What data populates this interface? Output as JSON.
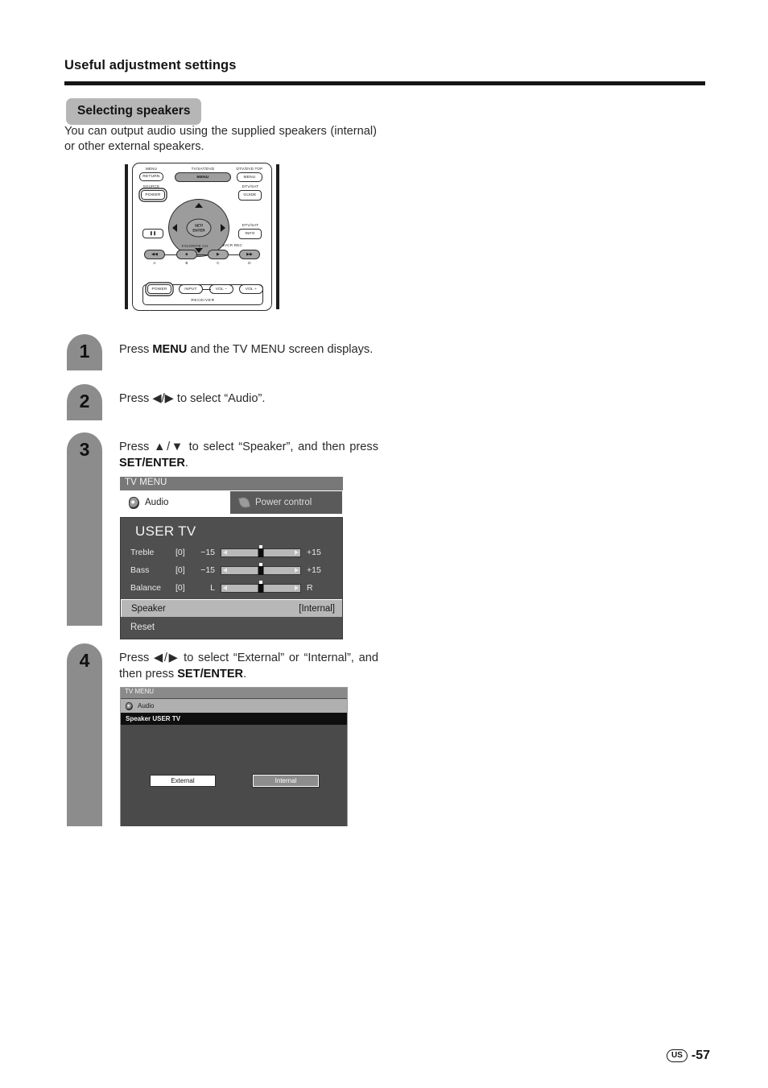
{
  "header": {
    "title": "Useful adjustment settings",
    "section_chip": "Selecting speakers",
    "intro": "You can output audio using the supplied speakers (internal) or other external speakers."
  },
  "remote": {
    "labels": {
      "menu": "MENU",
      "tv_sat_dvd": "TV/SAT/DVD",
      "dtv_dvd_top": "DTV/DVD TOP",
      "source": "SOURCE",
      "dtv_sat_guide": "DTV/SAT",
      "dtv_sat_info": "DTV/SAT",
      "favorite_ch": "FAVORITE CH",
      "vcr_rec": "VCR REC",
      "receiver": "RECEIVER"
    },
    "buttons": {
      "return": "RETURN",
      "menu_center": "MENU",
      "menu_right": "MENU",
      "power_source": "POWER",
      "guide": "GUIDE",
      "info": "INFO",
      "pause": "❚❚",
      "rewind": "◀◀",
      "stop": "■",
      "play": "▶",
      "forward": "▶▶",
      "set_enter_line1": "SET/",
      "set_enter_line2": "ENTER",
      "power_receiver": "POWER",
      "input": "INPUT",
      "vol_minus": "VOL −",
      "vol_plus": "VOL +"
    },
    "color_letters": [
      "A",
      "B",
      "C",
      "D"
    ]
  },
  "steps": [
    {
      "number": "1",
      "text_html": "Press <b>MENU</b> and the TV MENU screen displays."
    },
    {
      "number": "2",
      "text_html": "Press ◀/▶ to select “Audio”."
    },
    {
      "number": "3",
      "text_html": "Press ▲/▼ to select “Speaker”, and then press <b>SET/ENTER</b>."
    },
    {
      "number": "4",
      "text_html": "Press ◀/▶ to select “External” or “Internal”, and then press <b>SET/ENTER</b>."
    }
  ],
  "osd_step3": {
    "title": "TV MENU",
    "tabs": [
      {
        "label": "Audio",
        "icon": "speaker-icon",
        "active": true
      },
      {
        "label": "Power control",
        "icon": "leaf-icon",
        "active": false
      }
    ],
    "panel_title": "USER TV",
    "sliders": [
      {
        "name": "Treble",
        "value": "[0]",
        "min": "−15",
        "max": "+15"
      },
      {
        "name": "Bass",
        "value": "[0]",
        "min": "−15",
        "max": "+15"
      },
      {
        "name": "Balance",
        "value": "[0]",
        "min": "L",
        "max": "R"
      }
    ],
    "options": [
      {
        "label": "Speaker",
        "value": "[Internal]",
        "selected": true
      },
      {
        "label": "Reset",
        "value": "",
        "selected": false
      }
    ]
  },
  "osd_step4": {
    "title": "TV MENU",
    "tab_label": "Audio",
    "subtitle": "Speaker USER TV",
    "choices": [
      {
        "label": "External",
        "highlighted": true
      },
      {
        "label": "Internal",
        "highlighted": false
      }
    ]
  },
  "footer": {
    "region": "US",
    "page": "-57"
  }
}
